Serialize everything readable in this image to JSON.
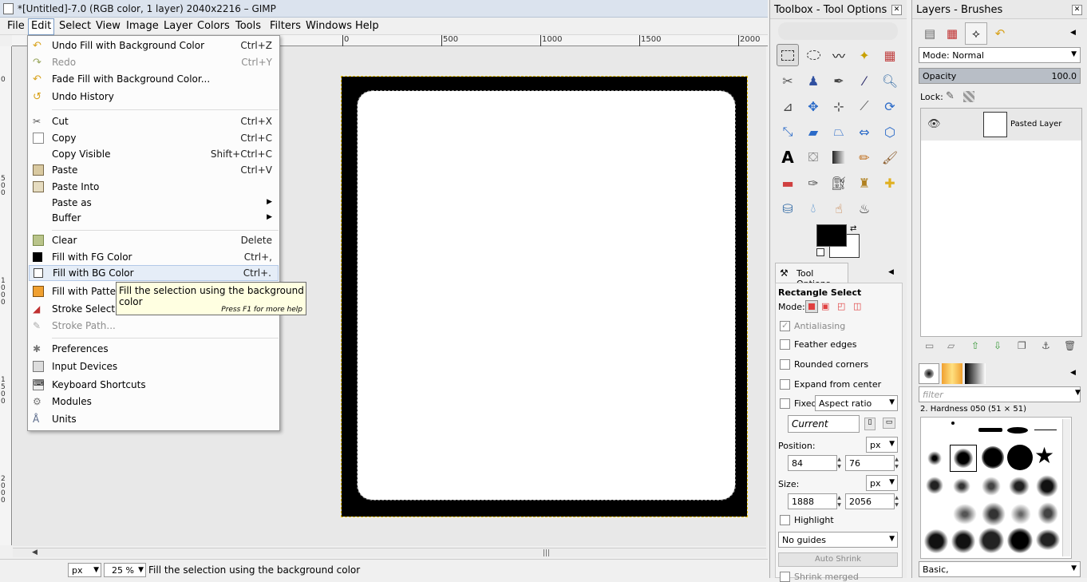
{
  "window": {
    "title": "*[Untitled]-7.0 (RGB color, 1 layer) 2040x2216 – GIMP"
  },
  "menubar": {
    "items": [
      "File",
      "Edit",
      "Select",
      "View",
      "Image",
      "Layer",
      "Colors",
      "Tools",
      "Filters",
      "Windows",
      "Help"
    ],
    "active": "Edit"
  },
  "ruler": {
    "h": [
      "0",
      "500",
      "1000",
      "1500",
      "2000"
    ],
    "v": [
      "0",
      "5\n0\n0",
      "1\n0\n0\n0",
      "1\n5\n0\n0",
      "2\n0\n0\n0"
    ]
  },
  "edit_menu": {
    "items": [
      {
        "label": "Undo Fill with Background Color",
        "shortcut": "Ctrl+Z",
        "icon": "undo-icon",
        "disabled": false
      },
      {
        "label": "Redo",
        "shortcut": "Ctrl+Y",
        "icon": "redo-icon",
        "disabled": true
      },
      {
        "label": "Fade Fill with Background Color...",
        "shortcut": "",
        "icon": "fade-icon",
        "disabled": false
      },
      {
        "label": "Undo History",
        "shortcut": "",
        "icon": "undo-history-icon",
        "disabled": false
      },
      {
        "label": "Cut",
        "shortcut": "Ctrl+X",
        "icon": "cut-icon",
        "disabled": false
      },
      {
        "label": "Copy",
        "shortcut": "Ctrl+C",
        "icon": "copy-icon",
        "disabled": false
      },
      {
        "label": "Copy Visible",
        "shortcut": "Shift+Ctrl+C",
        "icon": "",
        "disabled": false
      },
      {
        "label": "Paste",
        "shortcut": "Ctrl+V",
        "icon": "paste-icon",
        "disabled": false
      },
      {
        "label": "Paste Into",
        "shortcut": "",
        "icon": "paste-into-icon",
        "disabled": false
      },
      {
        "label": "Paste as",
        "shortcut": "",
        "icon": "",
        "disabled": false
      },
      {
        "label": "Buffer",
        "shortcut": "",
        "icon": "",
        "disabled": false
      },
      {
        "label": "Clear",
        "shortcut": "Delete",
        "icon": "clear-icon",
        "disabled": false
      },
      {
        "label": "Fill with FG Color",
        "shortcut": "Ctrl+,",
        "icon": "fg-fill-icon",
        "disabled": false
      },
      {
        "label": "Fill with BG Color",
        "shortcut": "Ctrl+.",
        "icon": "bg-fill-icon",
        "disabled": false
      },
      {
        "label": "Fill with Pattern",
        "shortcut": "",
        "icon": "pattern-fill-icon",
        "disabled": false
      },
      {
        "label": "Stroke Selection...",
        "shortcut": "",
        "icon": "stroke-selection-icon",
        "disabled": false
      },
      {
        "label": "Stroke Path...",
        "shortcut": "",
        "icon": "stroke-path-icon",
        "disabled": true
      },
      {
        "label": "Preferences",
        "shortcut": "",
        "icon": "preferences-icon",
        "disabled": false
      },
      {
        "label": "Input Devices",
        "shortcut": "",
        "icon": "input-devices-icon",
        "disabled": false
      },
      {
        "label": "Keyboard Shortcuts",
        "shortcut": "",
        "icon": "keyboard-icon",
        "disabled": false
      },
      {
        "label": "Modules",
        "shortcut": "",
        "icon": "modules-icon",
        "disabled": false
      },
      {
        "label": "Units",
        "shortcut": "",
        "icon": "units-icon",
        "disabled": false
      }
    ]
  },
  "tooltip": {
    "text": "Fill the selection using the background color",
    "help": "Press F1 for more help"
  },
  "status": {
    "unit": "px",
    "zoom": "25 %",
    "message": "Fill the selection using the background color"
  },
  "toolbox": {
    "title": "Toolbox - Tool Options",
    "tab": "Tool Options",
    "tool_name": "Rectangle Select"
  },
  "tool_options": {
    "mode_label": "Mode:",
    "antialiasing": "Antialiasing",
    "feather": "Feather edges",
    "rounded": "Rounded corners",
    "expand": "Expand from center",
    "fixed": "Fixed:",
    "fixed_value": "Aspect ratio",
    "current": "Current",
    "position_label": "Position:",
    "pos_unit": "px",
    "pos_x": "84",
    "pos_y": "76",
    "size_label": "Size:",
    "size_unit": "px",
    "size_w": "1888",
    "size_h": "2056",
    "highlight": "Highlight",
    "guides": "No guides",
    "auto_shrink": "Auto Shrink",
    "shrink_merged": "Shrink merged"
  },
  "layers": {
    "title": "Layers - Brushes",
    "mode_label": "Mode:",
    "mode": "Normal",
    "opacity_label": "Opacity",
    "opacity": "100.0",
    "lock_label": "Lock:",
    "layer_name": "Pasted Layer",
    "filter_placeholder": "filter",
    "brush_name": "2. Hardness 050 (51 × 51)",
    "brush_set": "Basic,"
  },
  "colors": {
    "accent": "#e5edf7",
    "fg": "#000000",
    "bg": "#ffffff",
    "selection": "#e6c000"
  }
}
